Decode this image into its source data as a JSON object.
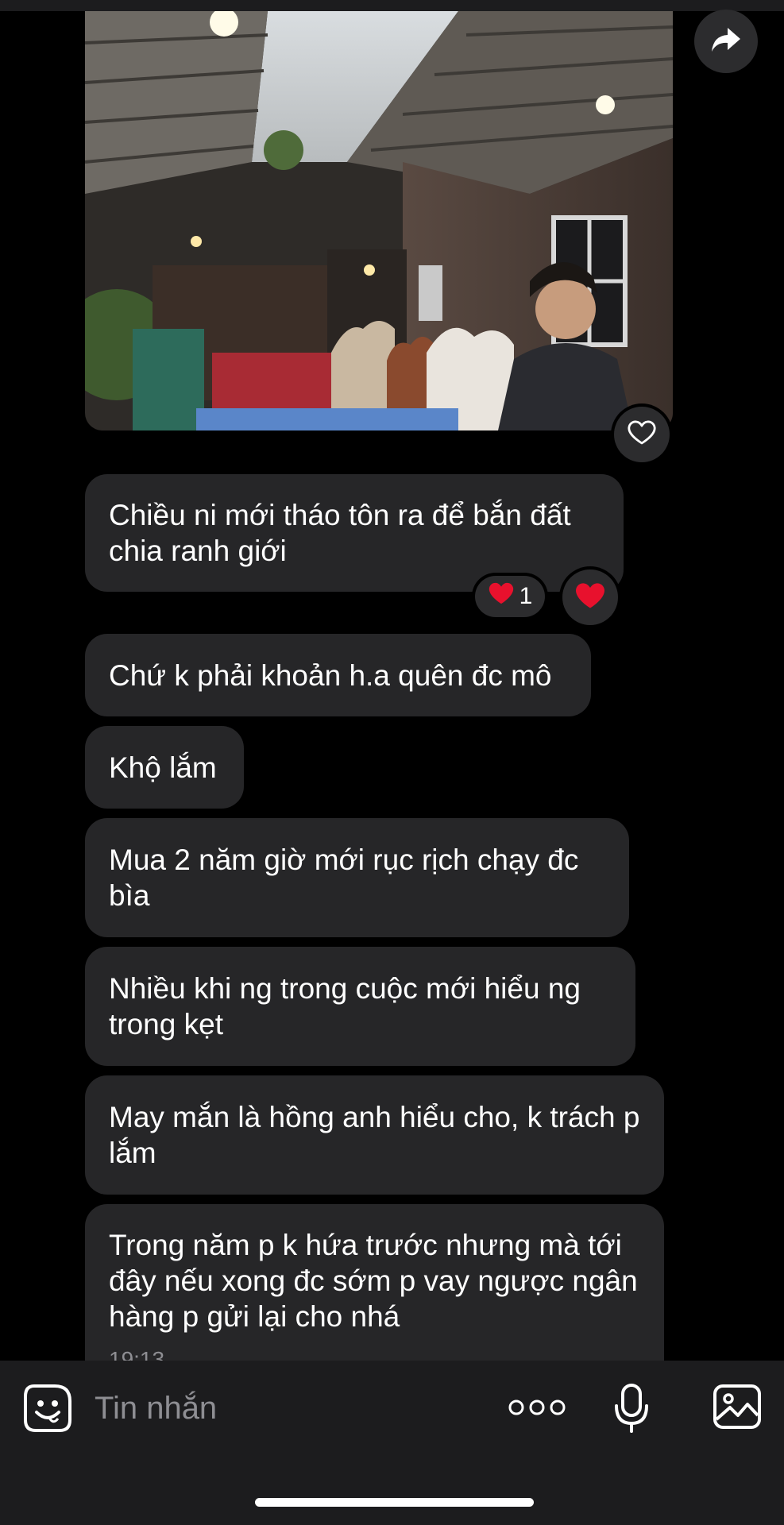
{
  "messages": [
    {
      "text": "Chiều ni mới tháo tôn ra để bắn đất chia ranh giới"
    },
    {
      "text": "Chứ k phải khoản h.a quên đc mô"
    },
    {
      "text": "Khộ lắm"
    },
    {
      "text": "Mua 2 năm giờ mới rục rịch chạy đc bìa"
    },
    {
      "text": "Nhiều khi ng trong cuộc mới hiểu ng trong kẹt"
    },
    {
      "text": "May mắn là hồng anh hiểu cho, k trách p lắm"
    },
    {
      "text": "Trong năm p k hứa trước nhưng mà tới đây nếu xong đc sớm p vay ngược ngân hàng p gửi lại cho nhá"
    }
  ],
  "reaction": {
    "emoji": "❤️",
    "count": "1"
  },
  "timestamp": "19:13",
  "composer": {
    "placeholder": "Tin nhắn"
  },
  "icons": {
    "share": "share-arrow-icon",
    "like": "heart-outline-icon",
    "sticker": "sticker-face-icon",
    "more": "more-dots-icon",
    "mic": "microphone-icon",
    "gallery": "gallery-icon"
  },
  "colors": {
    "bubble": "#262628",
    "heart": "#e8112d",
    "background": "#000000"
  }
}
